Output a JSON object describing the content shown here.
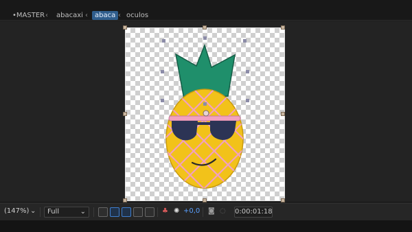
{
  "breadcrumbs": [
    {
      "label": "•MASTER"
    },
    {
      "label": "abacaxi"
    },
    {
      "label": "abaca"
    },
    {
      "label": "oculos"
    }
  ],
  "viewer": {
    "zoom": "(147%)",
    "resolution": "Full",
    "exposure": "+0,0",
    "timecode": "0:00:01:18"
  },
  "colors": {
    "crown": "#1f8f6b",
    "pineapple": "#f2c21a",
    "lattice": "#f2a0c0",
    "glasses": "#2c3455",
    "band": "#f2a0c0",
    "accent_blue": "#3f7fd1"
  },
  "icons": [
    "chevron-left-icon",
    "dropdown-icon",
    "snapshot-icon",
    "grid-icon",
    "mask-icon",
    "channel-icon",
    "exposure-icon"
  ]
}
